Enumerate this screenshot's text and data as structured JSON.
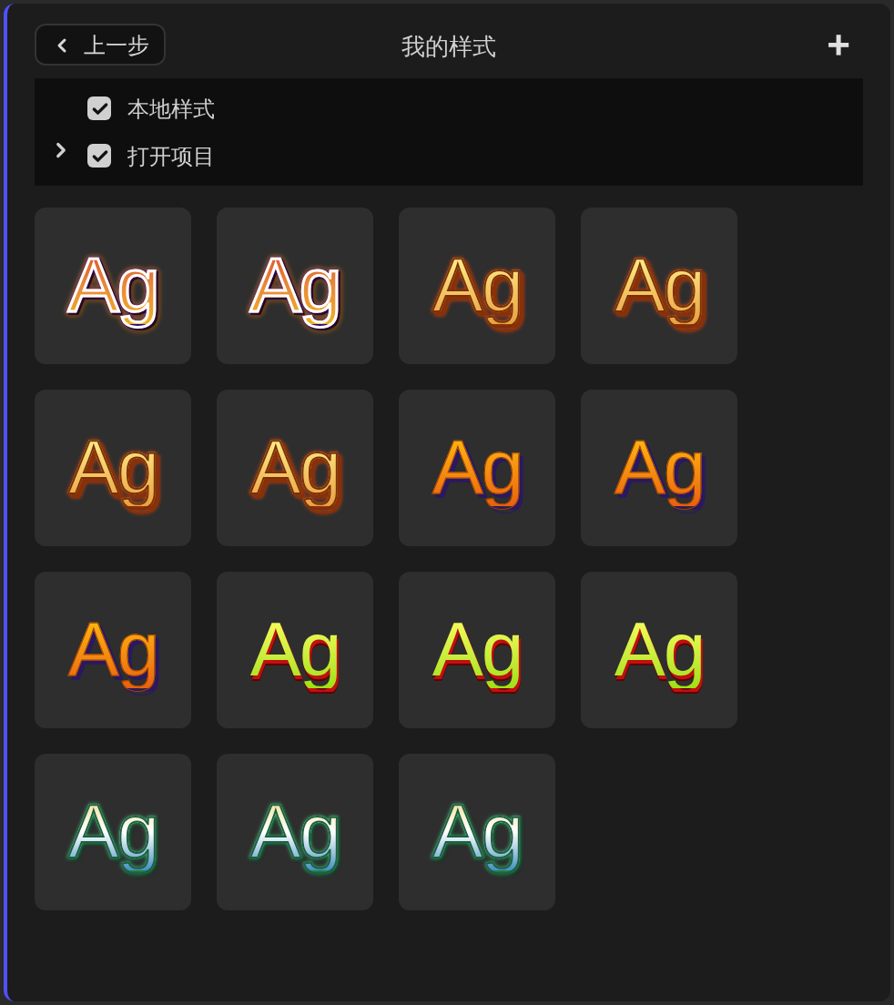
{
  "header": {
    "back_button": "上一步",
    "title": "我的样式",
    "add_button": "+"
  },
  "filters": [
    {
      "label": "本地样式",
      "checked": true,
      "kind": "leaf"
    },
    {
      "label": "打开项目",
      "checked": true,
      "kind": "folder",
      "expanded": false
    }
  ],
  "styles": [
    {
      "text": "Ag",
      "kind": "rainbow"
    },
    {
      "text": "Ag",
      "kind": "rainbow"
    },
    {
      "text": "Ag",
      "kind": "gold"
    },
    {
      "text": "Ag",
      "kind": "gold"
    },
    {
      "text": "Ag",
      "kind": "gold"
    },
    {
      "text": "Ag",
      "kind": "gold"
    },
    {
      "text": "Ag",
      "kind": "amber"
    },
    {
      "text": "Ag",
      "kind": "amber"
    },
    {
      "text": "Ag",
      "kind": "amber"
    },
    {
      "text": "Ag",
      "kind": "lime"
    },
    {
      "text": "Ag",
      "kind": "lime"
    },
    {
      "text": "Ag",
      "kind": "lime"
    },
    {
      "text": "Ag",
      "kind": "teal"
    },
    {
      "text": "Ag",
      "kind": "teal"
    },
    {
      "text": "Ag",
      "kind": "teal"
    }
  ]
}
